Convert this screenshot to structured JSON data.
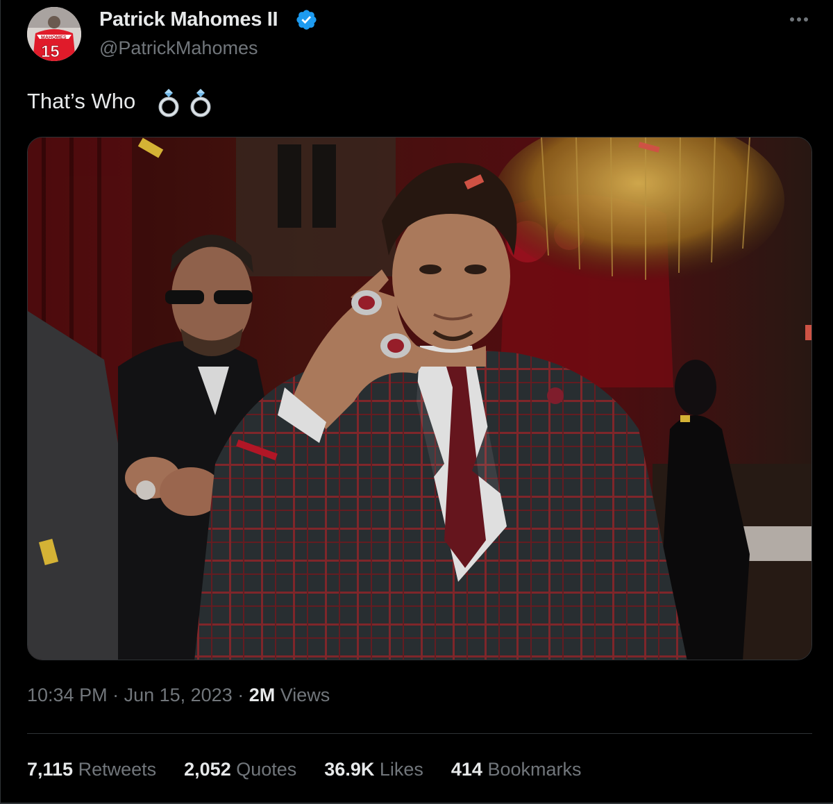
{
  "author": {
    "display_name": "Patrick Mahomes II",
    "handle": "@PatrickMahomes",
    "verified": true,
    "avatar_jersey_number": "15",
    "avatar_jersey_text": "MAHOMES"
  },
  "tweet": {
    "text": "That’s Who",
    "emoji": "💍💍",
    "media_alt": "photo"
  },
  "meta": {
    "time": "10:34 PM",
    "separator": " · ",
    "date": "Jun 15, 2023",
    "views_count": "2M",
    "views_label": " Views"
  },
  "stats": [
    {
      "count": "7,115",
      "label": " Retweets"
    },
    {
      "count": "2,052",
      "label": " Quotes"
    },
    {
      "count": "36.9K",
      "label": " Likes"
    },
    {
      "count": "414",
      "label": " Bookmarks"
    }
  ],
  "colors": {
    "background": "#000000",
    "primary_text": "#e7e9ea",
    "secondary_text": "#71767b",
    "divider": "#2f3336",
    "verified_blue": "#1d9bf0"
  }
}
